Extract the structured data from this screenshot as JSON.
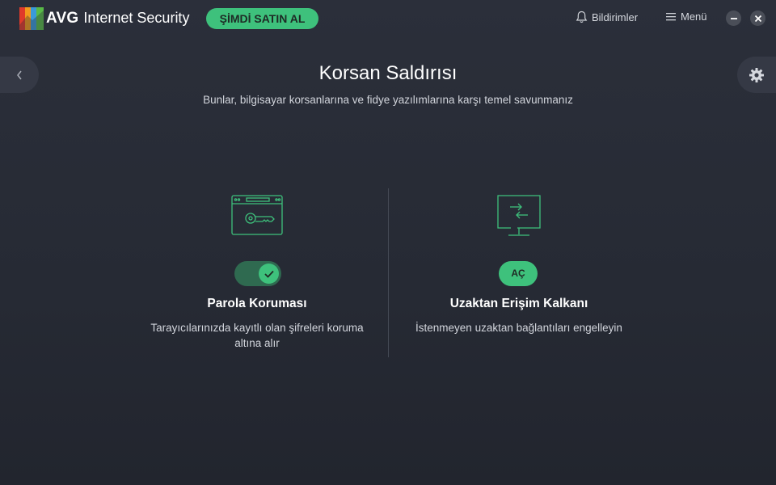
{
  "header": {
    "brand_name": "AVG",
    "product_name": "Internet Security",
    "buy_label": "ŞİMDİ SATIN AL",
    "notifications_label": "Bildirimler",
    "menu_label": "Menü"
  },
  "page": {
    "title": "Korsan Saldırısı",
    "subtitle": "Bunlar, bilgisayar korsanlarına ve fidye yazılımlarına karşı temel savunmanız"
  },
  "features": [
    {
      "title": "Parola Koruması",
      "description": "Tarayıcılarınızda kayıtlı olan şifreleri koruma altına alır",
      "enabled": true
    },
    {
      "title": "Uzaktan Erişim Kalkanı",
      "description": "İstenmeyen uzaktan bağlantıları engelleyin",
      "action_label": "AÇ",
      "enabled": false
    }
  ],
  "colors": {
    "accent": "#3ec17c",
    "background": "#2b2f3a",
    "toggle_track": "#2f6a50"
  },
  "icons": [
    "avg-logo-icon",
    "bell-icon",
    "hamburger-icon",
    "minimize-icon",
    "close-icon",
    "chevron-left-icon",
    "gear-icon",
    "browser-key-icon",
    "remote-monitor-icon",
    "checkmark-icon"
  ]
}
